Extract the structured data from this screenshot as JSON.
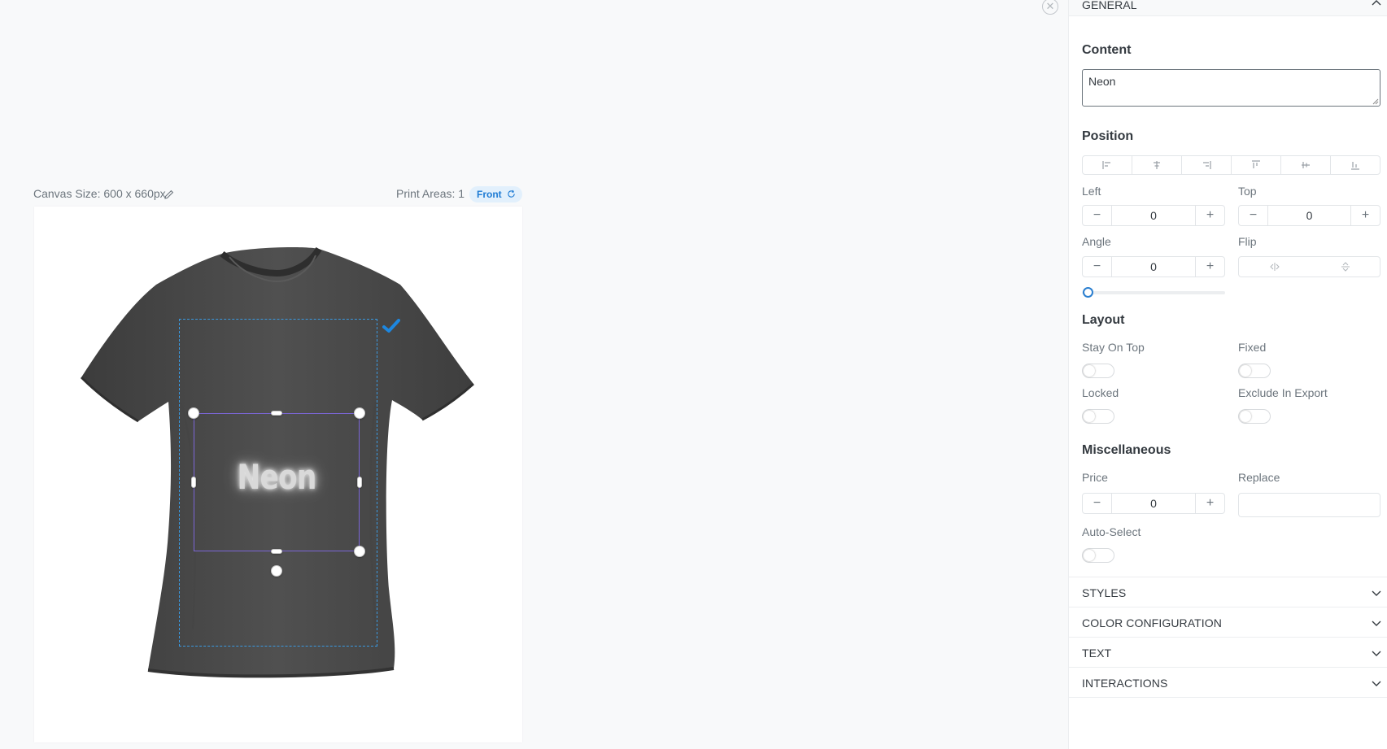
{
  "canvas": {
    "size_label": "Canvas Size: 600 x 660px",
    "print_areas_label": "Print Areas: 1",
    "front_badge": "Front",
    "element_text": "Neon"
  },
  "panel": {
    "general": {
      "label": "GENERAL"
    },
    "content": {
      "title": "Content",
      "value": "Neon"
    },
    "position": {
      "title": "Position",
      "align_icons": [
        "align-left-icon",
        "align-center-horizontal-icon",
        "align-right-icon",
        "align-top-icon",
        "align-middle-vertical-icon",
        "align-bottom-icon"
      ],
      "left": {
        "label": "Left",
        "value": "0"
      },
      "top": {
        "label": "Top",
        "value": "0"
      },
      "angle": {
        "label": "Angle",
        "value": "0"
      },
      "flip": {
        "label": "Flip"
      },
      "angle_slider_value": 0
    },
    "layout": {
      "title": "Layout",
      "stay_on_top": {
        "label": "Stay On Top",
        "on": false
      },
      "fixed": {
        "label": "Fixed",
        "on": false
      },
      "locked": {
        "label": "Locked",
        "on": false
      },
      "exclude_in_export": {
        "label": "Exclude In Export",
        "on": false
      }
    },
    "misc": {
      "title": "Miscellaneous",
      "price": {
        "label": "Price",
        "value": "0"
      },
      "replace": {
        "label": "Replace",
        "value": ""
      },
      "auto_select": {
        "label": "Auto-Select",
        "on": false
      }
    },
    "sections": [
      {
        "label": "STYLES"
      },
      {
        "label": "COLOR CONFIGURATION"
      },
      {
        "label": "TEXT"
      },
      {
        "label": "INTERACTIONS"
      }
    ]
  },
  "colors": {
    "accent_blue": "#1d7bd4",
    "selection_purple": "#7b66d6",
    "print_area_dashed": "#3a99e0",
    "shirt": "#4a4a4a"
  }
}
